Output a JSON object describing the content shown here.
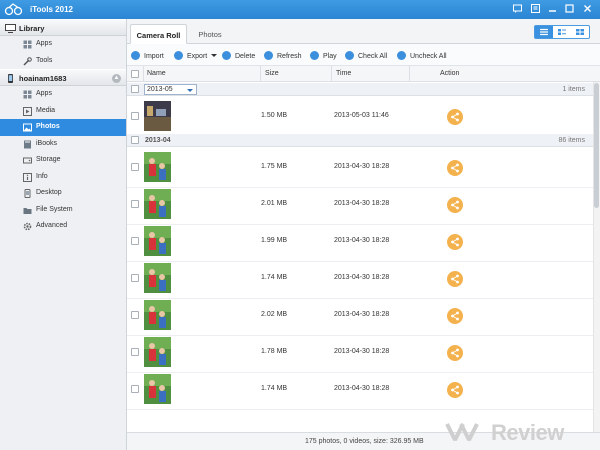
{
  "app": {
    "title": "iTools 2012",
    "accent": "#2e8be0"
  },
  "sidebar": {
    "library": {
      "label": "Library",
      "items": [
        {
          "label": "Apps",
          "icon": "apps-icon"
        },
        {
          "label": "Tools",
          "icon": "tools-icon"
        }
      ]
    },
    "device": {
      "label": "hoainam1683",
      "items": [
        {
          "label": "Apps",
          "icon": "apps-icon"
        },
        {
          "label": "Media",
          "icon": "media-icon"
        },
        {
          "label": "Photos",
          "icon": "photos-icon",
          "active": true
        },
        {
          "label": "iBooks",
          "icon": "ibooks-icon"
        },
        {
          "label": "Storage",
          "icon": "storage-icon"
        },
        {
          "label": "Info",
          "icon": "info-icon"
        },
        {
          "label": "Desktop",
          "icon": "desktop-icon"
        },
        {
          "label": "File System",
          "icon": "folder-icon"
        },
        {
          "label": "Advanced",
          "icon": "gear-icon"
        }
      ]
    }
  },
  "tabs": [
    {
      "label": "Camera Roll",
      "active": true
    },
    {
      "label": "Photos",
      "active": false
    }
  ],
  "toolbar": {
    "import": "Import",
    "export": "Export",
    "delete": "Delete",
    "refresh": "Refresh",
    "play": "Play",
    "check_all": "Check All",
    "uncheck_all": "Uncheck All"
  },
  "columns": {
    "name": "Name",
    "size": "Size",
    "time": "Time",
    "action": "Action"
  },
  "groups": [
    {
      "label": "2013-05",
      "count": "1 items",
      "is_select": true,
      "rows": [
        {
          "size": "1.50 MB",
          "time": "2013-05-03 11:46"
        }
      ]
    },
    {
      "label": "2013-04",
      "count": "86 items",
      "is_select": false,
      "rows": [
        {
          "size": "1.75 MB",
          "time": "2013-04-30 18:28"
        },
        {
          "size": "2.01 MB",
          "time": "2013-04-30 18:28"
        },
        {
          "size": "1.99 MB",
          "time": "2013-04-30 18:28"
        },
        {
          "size": "1.74 MB",
          "time": "2013-04-30 18:28"
        },
        {
          "size": "2.02 MB",
          "time": "2013-04-30 18:28"
        },
        {
          "size": "1.78 MB",
          "time": "2013-04-30 18:28"
        },
        {
          "size": "1.74 MB",
          "time": "2013-04-30 18:28"
        }
      ]
    }
  ],
  "status": {
    "text": "175 photos, 0 videos, size: 326.95 MB"
  },
  "watermark": {
    "text": "Review",
    "logo": "VN"
  }
}
